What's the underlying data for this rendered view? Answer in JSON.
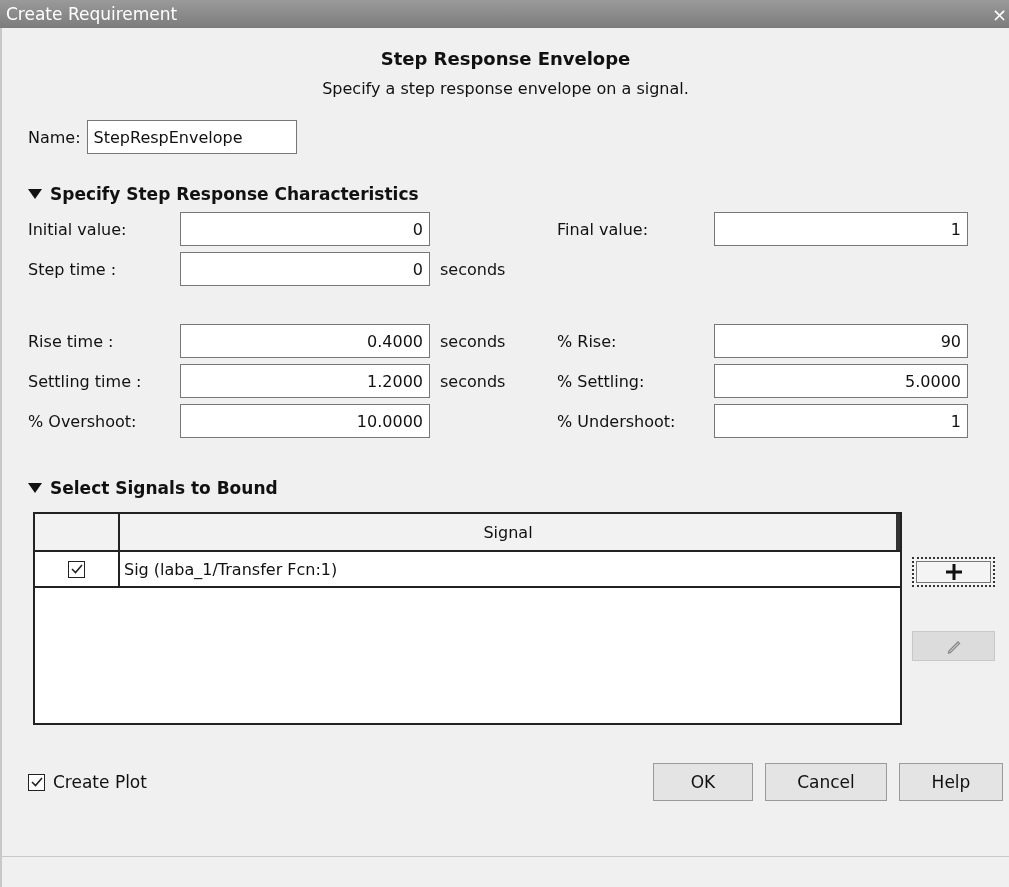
{
  "window": {
    "title": "Create Requirement",
    "close": "×"
  },
  "header": {
    "title": "Step Response Envelope",
    "subtitle": "Specify a step response envelope on a signal."
  },
  "name_field": {
    "label": "Name:",
    "value": "StepRespEnvelope"
  },
  "characteristics": {
    "title": "Specify Step Response Characteristics",
    "expanded": true,
    "groups": [
      [
        {
          "left": {
            "label": "Initial value:",
            "value": "0"
          },
          "right": {
            "label": "Final value:",
            "value": "1"
          }
        },
        {
          "left": {
            "label": "Step time :",
            "value": "0",
            "unit": "seconds"
          }
        }
      ],
      [
        {
          "left": {
            "label": "Rise time :",
            "value": "0.4000",
            "unit": "seconds"
          },
          "right": {
            "label": "% Rise:",
            "value": "90"
          }
        },
        {
          "left": {
            "label": "Settling time :",
            "value": "1.2000",
            "unit": "seconds"
          },
          "right": {
            "label": "% Settling:",
            "value": "5.0000"
          }
        },
        {
          "left": {
            "label": "% Overshoot:",
            "value": "10.0000"
          },
          "right": {
            "label": "% Undershoot:",
            "value": "1"
          }
        }
      ]
    ]
  },
  "signals": {
    "title": "Select Signals to Bound",
    "expanded": true,
    "table": {
      "columns": [
        "Signal"
      ],
      "rows": [
        {
          "checked": true,
          "signal": "Sig (laba_1/Transfer Fcn:1)"
        }
      ]
    },
    "side_buttons": [
      {
        "kind": "add",
        "disabled": false
      },
      {
        "kind": "edit",
        "disabled": true
      }
    ]
  },
  "create_plot": {
    "label": "Create Plot",
    "checked": true
  },
  "buttons": [
    "OK",
    "Cancel",
    "Help"
  ]
}
